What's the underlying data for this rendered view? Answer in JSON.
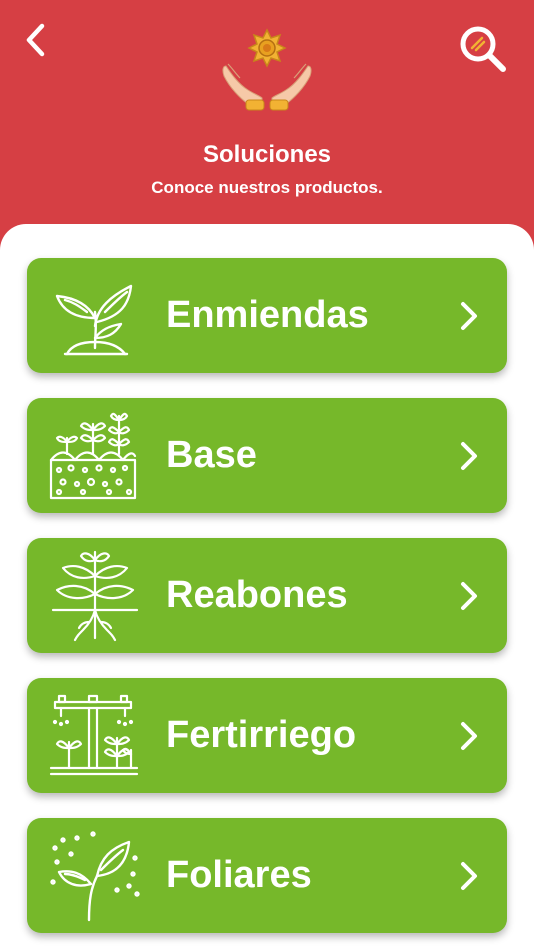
{
  "header": {
    "title": "Soluciones",
    "subtitle": "Conoce nuestros productos.",
    "back_icon": "chevron-left-icon",
    "search_icon": "search-icon",
    "hero_icon": "hands-holding-sun-icon",
    "bg_color": "#d63f44"
  },
  "menu": {
    "accent_color": "#76b82a",
    "items": [
      {
        "label": "Enmiendas",
        "icon": "sprout-icon"
      },
      {
        "label": "Base",
        "icon": "seedbed-icon"
      },
      {
        "label": "Reabones",
        "icon": "rooted-plant-icon"
      },
      {
        "label": "Fertirriego",
        "icon": "irrigation-icon"
      },
      {
        "label": "Foliares",
        "icon": "leaf-spray-icon"
      }
    ]
  }
}
